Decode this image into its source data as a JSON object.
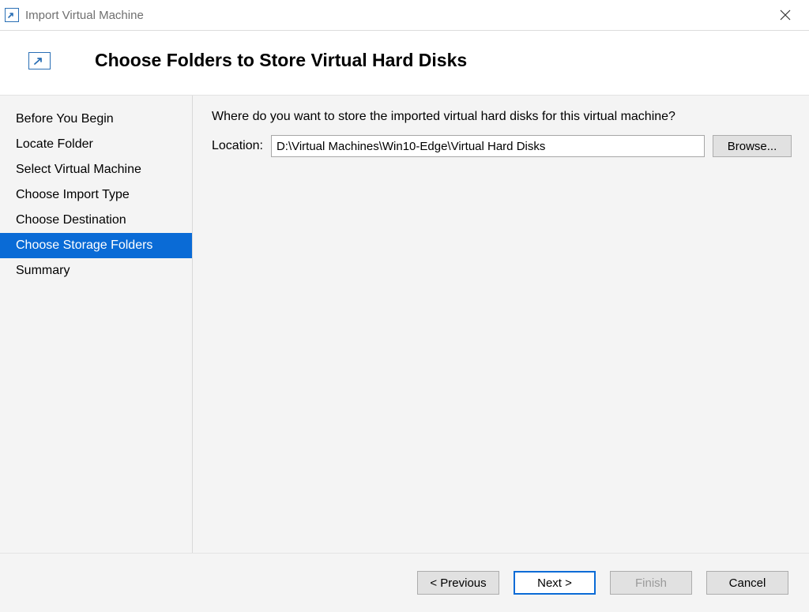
{
  "window": {
    "title": "Import Virtual Machine"
  },
  "header": {
    "title": "Choose Folders to Store Virtual Hard Disks"
  },
  "sidebar": {
    "items": [
      {
        "label": "Before You Begin",
        "selected": false
      },
      {
        "label": "Locate Folder",
        "selected": false
      },
      {
        "label": "Select Virtual Machine",
        "selected": false
      },
      {
        "label": "Choose Import Type",
        "selected": false
      },
      {
        "label": "Choose Destination",
        "selected": false
      },
      {
        "label": "Choose Storage Folders",
        "selected": true
      },
      {
        "label": "Summary",
        "selected": false
      }
    ]
  },
  "content": {
    "question": "Where do you want to store the imported virtual hard disks for this virtual machine?",
    "location_label": "Location:",
    "location_value": "D:\\Virtual Machines\\Win10-Edge\\Virtual Hard Disks",
    "browse_label": "Browse..."
  },
  "footer": {
    "previous": "< Previous",
    "next": "Next >",
    "finish": "Finish",
    "cancel": "Cancel"
  }
}
